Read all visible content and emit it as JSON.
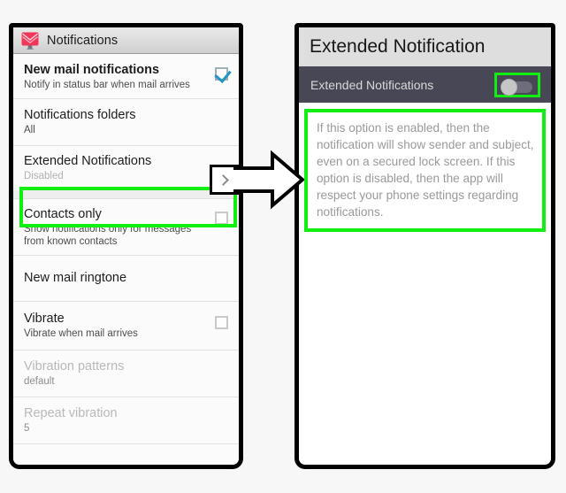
{
  "left_panel": {
    "app_icon": "mail-envelope-icon",
    "header_title": "Notifications",
    "rows": [
      {
        "title": "New mail notifications",
        "subtitle": "Notify in status bar when mail arrives",
        "widget": "checkbox",
        "checked": true,
        "bold": true,
        "disabled": false
      },
      {
        "title": "Notifications folders",
        "subtitle": "All",
        "widget": "none",
        "checked": false,
        "bold": false,
        "disabled": false
      },
      {
        "title": "Extended Notifications",
        "subtitle": "Disabled",
        "widget": "chevron",
        "checked": false,
        "bold": false,
        "disabled": false,
        "highlighted": true
      },
      {
        "title": "Contacts only",
        "subtitle": "Show notifications only for messages from known contacts",
        "widget": "checkbox",
        "checked": false,
        "bold": false,
        "disabled": false
      },
      {
        "title": "New mail ringtone",
        "subtitle": "",
        "widget": "none",
        "checked": false,
        "bold": false,
        "disabled": false
      },
      {
        "title": "Vibrate",
        "subtitle": "Vibrate when mail arrives",
        "widget": "checkbox",
        "checked": false,
        "bold": false,
        "disabled": false
      },
      {
        "title": "Vibration patterns",
        "subtitle": "default",
        "widget": "none",
        "checked": false,
        "bold": false,
        "disabled": true
      },
      {
        "title": "Repeat vibration",
        "subtitle": "5",
        "widget": "none",
        "checked": false,
        "bold": false,
        "disabled": true
      }
    ]
  },
  "right_panel": {
    "header_title": "Extended Notification",
    "preference_label": "Extended Notifications",
    "toggle_state": "off",
    "description": "If this option is enabled, then the notification will show sender and subject, even on a secured lock screen. If this option is disabled, then the app will respect your phone settings regarding notifications."
  },
  "annotations": {
    "arrow": "right-block-arrow",
    "highlight_color": "#11ef11"
  },
  "colors": {
    "canvas_background": "#f7f7f7",
    "left_header_background": "#dcdcdc",
    "right_header_background": "#dedede",
    "preference_bar_background": "#474756",
    "highlight_green": "#11ef11",
    "checkbox_check": "#2196c4",
    "mail_icon_red": "#f2365a"
  }
}
